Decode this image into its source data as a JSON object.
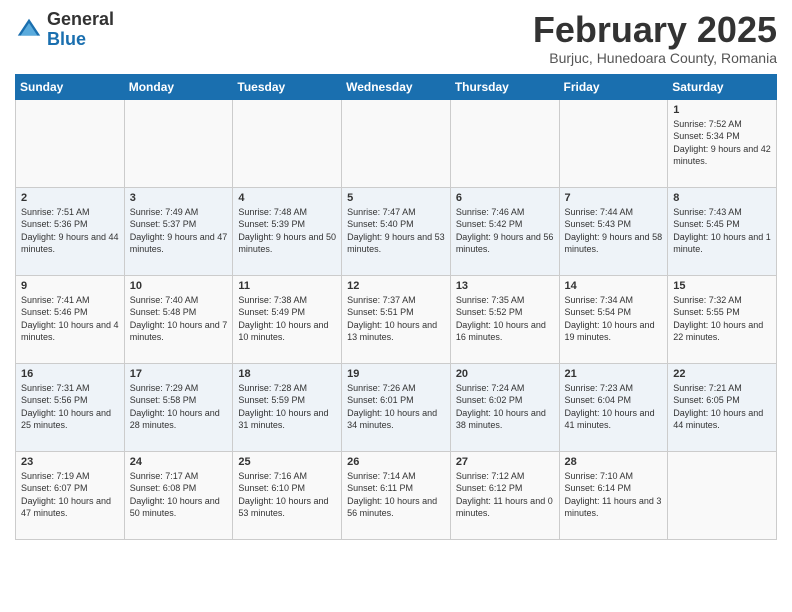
{
  "header": {
    "logo_general": "General",
    "logo_blue": "Blue",
    "month_title": "February 2025",
    "location": "Burjuc, Hunedoara County, Romania"
  },
  "weekdays": [
    "Sunday",
    "Monday",
    "Tuesday",
    "Wednesday",
    "Thursday",
    "Friday",
    "Saturday"
  ],
  "weeks": [
    [
      {
        "day": "",
        "info": ""
      },
      {
        "day": "",
        "info": ""
      },
      {
        "day": "",
        "info": ""
      },
      {
        "day": "",
        "info": ""
      },
      {
        "day": "",
        "info": ""
      },
      {
        "day": "",
        "info": ""
      },
      {
        "day": "1",
        "info": "Sunrise: 7:52 AM\nSunset: 5:34 PM\nDaylight: 9 hours and 42 minutes."
      }
    ],
    [
      {
        "day": "2",
        "info": "Sunrise: 7:51 AM\nSunset: 5:36 PM\nDaylight: 9 hours and 44 minutes."
      },
      {
        "day": "3",
        "info": "Sunrise: 7:49 AM\nSunset: 5:37 PM\nDaylight: 9 hours and 47 minutes."
      },
      {
        "day": "4",
        "info": "Sunrise: 7:48 AM\nSunset: 5:39 PM\nDaylight: 9 hours and 50 minutes."
      },
      {
        "day": "5",
        "info": "Sunrise: 7:47 AM\nSunset: 5:40 PM\nDaylight: 9 hours and 53 minutes."
      },
      {
        "day": "6",
        "info": "Sunrise: 7:46 AM\nSunset: 5:42 PM\nDaylight: 9 hours and 56 minutes."
      },
      {
        "day": "7",
        "info": "Sunrise: 7:44 AM\nSunset: 5:43 PM\nDaylight: 9 hours and 58 minutes."
      },
      {
        "day": "8",
        "info": "Sunrise: 7:43 AM\nSunset: 5:45 PM\nDaylight: 10 hours and 1 minute."
      }
    ],
    [
      {
        "day": "9",
        "info": "Sunrise: 7:41 AM\nSunset: 5:46 PM\nDaylight: 10 hours and 4 minutes."
      },
      {
        "day": "10",
        "info": "Sunrise: 7:40 AM\nSunset: 5:48 PM\nDaylight: 10 hours and 7 minutes."
      },
      {
        "day": "11",
        "info": "Sunrise: 7:38 AM\nSunset: 5:49 PM\nDaylight: 10 hours and 10 minutes."
      },
      {
        "day": "12",
        "info": "Sunrise: 7:37 AM\nSunset: 5:51 PM\nDaylight: 10 hours and 13 minutes."
      },
      {
        "day": "13",
        "info": "Sunrise: 7:35 AM\nSunset: 5:52 PM\nDaylight: 10 hours and 16 minutes."
      },
      {
        "day": "14",
        "info": "Sunrise: 7:34 AM\nSunset: 5:54 PM\nDaylight: 10 hours and 19 minutes."
      },
      {
        "day": "15",
        "info": "Sunrise: 7:32 AM\nSunset: 5:55 PM\nDaylight: 10 hours and 22 minutes."
      }
    ],
    [
      {
        "day": "16",
        "info": "Sunrise: 7:31 AM\nSunset: 5:56 PM\nDaylight: 10 hours and 25 minutes."
      },
      {
        "day": "17",
        "info": "Sunrise: 7:29 AM\nSunset: 5:58 PM\nDaylight: 10 hours and 28 minutes."
      },
      {
        "day": "18",
        "info": "Sunrise: 7:28 AM\nSunset: 5:59 PM\nDaylight: 10 hours and 31 minutes."
      },
      {
        "day": "19",
        "info": "Sunrise: 7:26 AM\nSunset: 6:01 PM\nDaylight: 10 hours and 34 minutes."
      },
      {
        "day": "20",
        "info": "Sunrise: 7:24 AM\nSunset: 6:02 PM\nDaylight: 10 hours and 38 minutes."
      },
      {
        "day": "21",
        "info": "Sunrise: 7:23 AM\nSunset: 6:04 PM\nDaylight: 10 hours and 41 minutes."
      },
      {
        "day": "22",
        "info": "Sunrise: 7:21 AM\nSunset: 6:05 PM\nDaylight: 10 hours and 44 minutes."
      }
    ],
    [
      {
        "day": "23",
        "info": "Sunrise: 7:19 AM\nSunset: 6:07 PM\nDaylight: 10 hours and 47 minutes."
      },
      {
        "day": "24",
        "info": "Sunrise: 7:17 AM\nSunset: 6:08 PM\nDaylight: 10 hours and 50 minutes."
      },
      {
        "day": "25",
        "info": "Sunrise: 7:16 AM\nSunset: 6:10 PM\nDaylight: 10 hours and 53 minutes."
      },
      {
        "day": "26",
        "info": "Sunrise: 7:14 AM\nSunset: 6:11 PM\nDaylight: 10 hours and 56 minutes."
      },
      {
        "day": "27",
        "info": "Sunrise: 7:12 AM\nSunset: 6:12 PM\nDaylight: 11 hours and 0 minutes."
      },
      {
        "day": "28",
        "info": "Sunrise: 7:10 AM\nSunset: 6:14 PM\nDaylight: 11 hours and 3 minutes."
      },
      {
        "day": "",
        "info": ""
      }
    ]
  ]
}
